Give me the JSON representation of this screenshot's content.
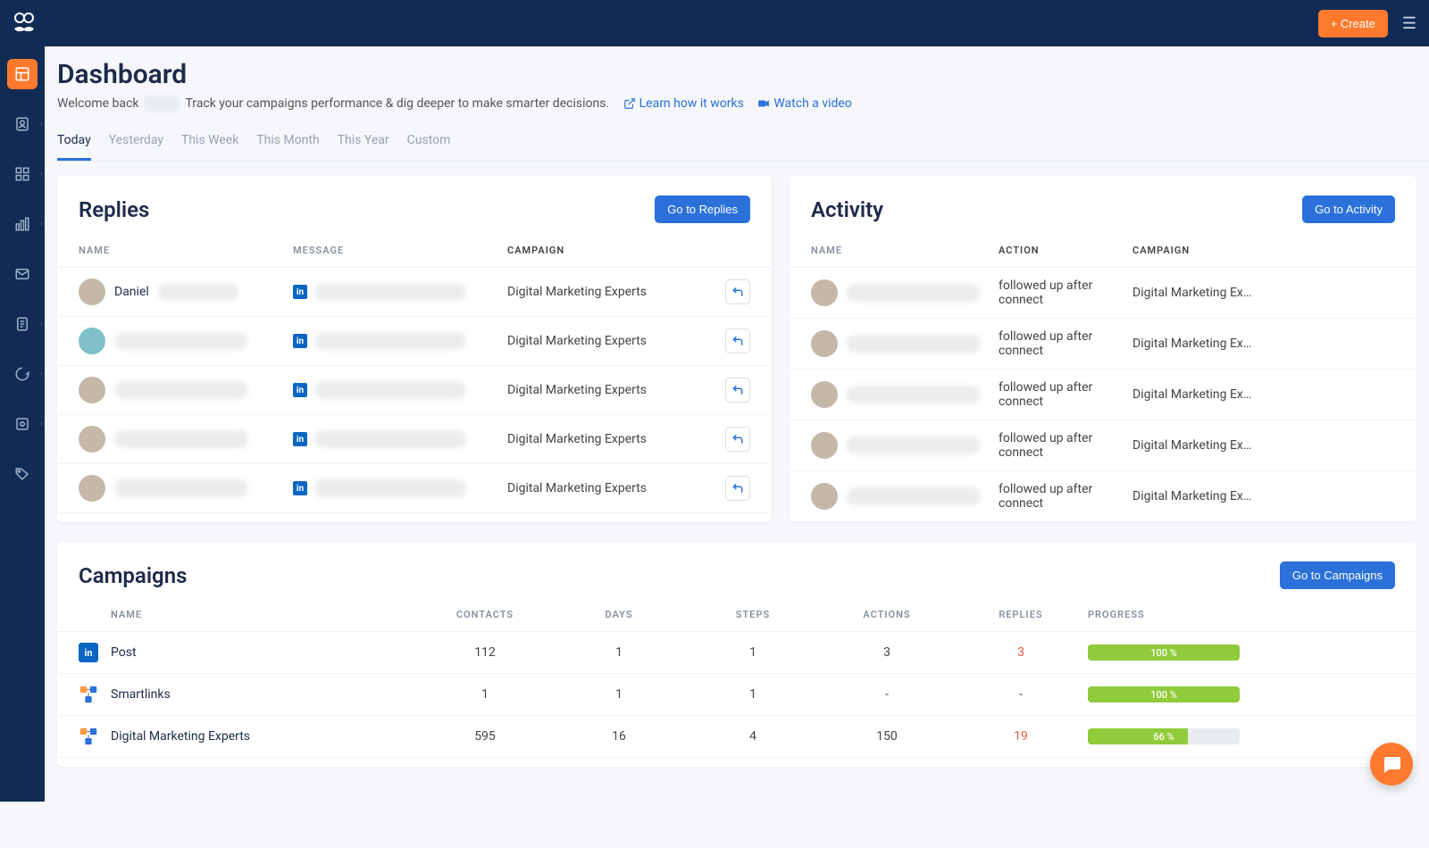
{
  "header": {
    "create_label": "+ Create"
  },
  "sidebar": {
    "items": [
      "dashboard",
      "contacts",
      "apps",
      "analytics",
      "inbox",
      "documents",
      "sync",
      "settings",
      "tags"
    ]
  },
  "page": {
    "title": "Dashboard",
    "welcome_prefix": "Welcome back",
    "welcome_suffix": "Track your campaigns performance & dig deeper to make smarter decisions.",
    "learn_link": "Learn how it works",
    "watch_link": "Watch a video"
  },
  "tabs": [
    "Today",
    "Yesterday",
    "This Week",
    "This Month",
    "This Year",
    "Custom"
  ],
  "replies": {
    "title": "Replies",
    "button": "Go to Replies",
    "columns": {
      "name": "NAME",
      "message": "MESSAGE",
      "campaign": "CAMPAIGN"
    },
    "rows": [
      {
        "name": "Daniel",
        "campaign": "Digital Marketing Experts",
        "avatar": "tan"
      },
      {
        "name": "",
        "campaign": "Digital Marketing Experts",
        "avatar": "teal"
      },
      {
        "name": "",
        "campaign": "Digital Marketing Experts",
        "avatar": "tan"
      },
      {
        "name": "",
        "campaign": "Digital Marketing Experts",
        "avatar": "tan"
      },
      {
        "name": "",
        "campaign": "Digital Marketing Experts",
        "avatar": "tan"
      }
    ]
  },
  "activity": {
    "title": "Activity",
    "button": "Go to Activity",
    "columns": {
      "name": "NAME",
      "action": "ACTION",
      "campaign": "CAMPAIGN"
    },
    "rows": [
      {
        "action": "followed up after connect",
        "campaign": "Digital Marketing Ex…"
      },
      {
        "action": "followed up after connect",
        "campaign": "Digital Marketing Ex…"
      },
      {
        "action": "followed up after connect",
        "campaign": "Digital Marketing Ex…"
      },
      {
        "action": "followed up after connect",
        "campaign": "Digital Marketing Ex…"
      },
      {
        "action": "followed up after connect",
        "campaign": "Digital Marketing Ex…"
      }
    ]
  },
  "campaigns": {
    "title": "Campaigns",
    "button": "Go to Campaigns",
    "columns": {
      "name": "NAME",
      "contacts": "CONTACTS",
      "days": "DAYS",
      "steps": "STEPS",
      "actions": "ACTIONS",
      "replies": "REPLIES",
      "progress": "PROGRESS"
    },
    "rows": [
      {
        "icon": "li",
        "name": "Post",
        "contacts": "112",
        "days": "1",
        "steps": "1",
        "actions": "3",
        "replies": "3",
        "replies_red": true,
        "progress": 100,
        "progress_label": "100 %"
      },
      {
        "icon": "flow",
        "name": "Smartlinks",
        "contacts": "1",
        "days": "1",
        "steps": "1",
        "actions": "-",
        "replies": "-",
        "replies_red": false,
        "progress": 100,
        "progress_label": "100 %"
      },
      {
        "icon": "flow",
        "name": "Digital Marketing Experts",
        "contacts": "595",
        "days": "16",
        "steps": "4",
        "actions": "150",
        "replies": "19",
        "replies_red": true,
        "progress": 66,
        "progress_label": "66 %"
      }
    ]
  }
}
